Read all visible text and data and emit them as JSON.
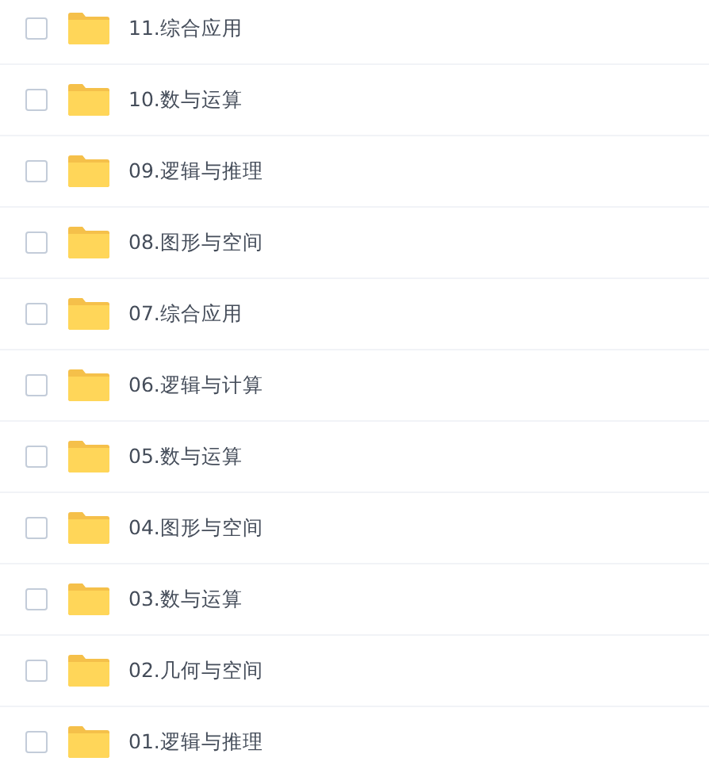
{
  "files": [
    {
      "name": "11.综合应用",
      "checked": false
    },
    {
      "name": "10.数与运算",
      "checked": false
    },
    {
      "name": "09.逻辑与推理",
      "checked": false
    },
    {
      "name": "08.图形与空间",
      "checked": false
    },
    {
      "name": "07.综合应用",
      "checked": false
    },
    {
      "name": "06.逻辑与计算",
      "checked": false
    },
    {
      "name": "05.数与运算",
      "checked": false
    },
    {
      "name": "04.图形与空间",
      "checked": false
    },
    {
      "name": "03.数与运算",
      "checked": false
    },
    {
      "name": "02.几何与空间",
      "checked": false
    },
    {
      "name": "01.逻辑与推理",
      "checked": false
    }
  ]
}
